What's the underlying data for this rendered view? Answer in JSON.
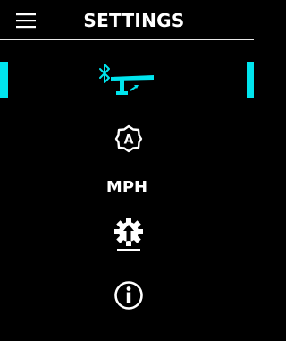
{
  "header": {
    "title": "SETTINGS",
    "menu_icon": "hamburger-menu-icon"
  },
  "menu": {
    "items": [
      {
        "id": "bluetooth-handlebar",
        "icon": "bluetooth-handlebar-icon",
        "selected": true
      },
      {
        "id": "auto-mode",
        "icon": "auto-mode-gear-icon",
        "icon_text": "A",
        "selected": false
      },
      {
        "id": "units",
        "label": "MPH",
        "selected": false
      },
      {
        "id": "firmware-update",
        "icon": "firmware-update-gear-icon",
        "selected": false
      },
      {
        "id": "info",
        "icon": "info-icon",
        "selected": false
      }
    ]
  },
  "colors": {
    "background": "#000000",
    "foreground": "#ffffff",
    "accent": "#00e5ee"
  }
}
